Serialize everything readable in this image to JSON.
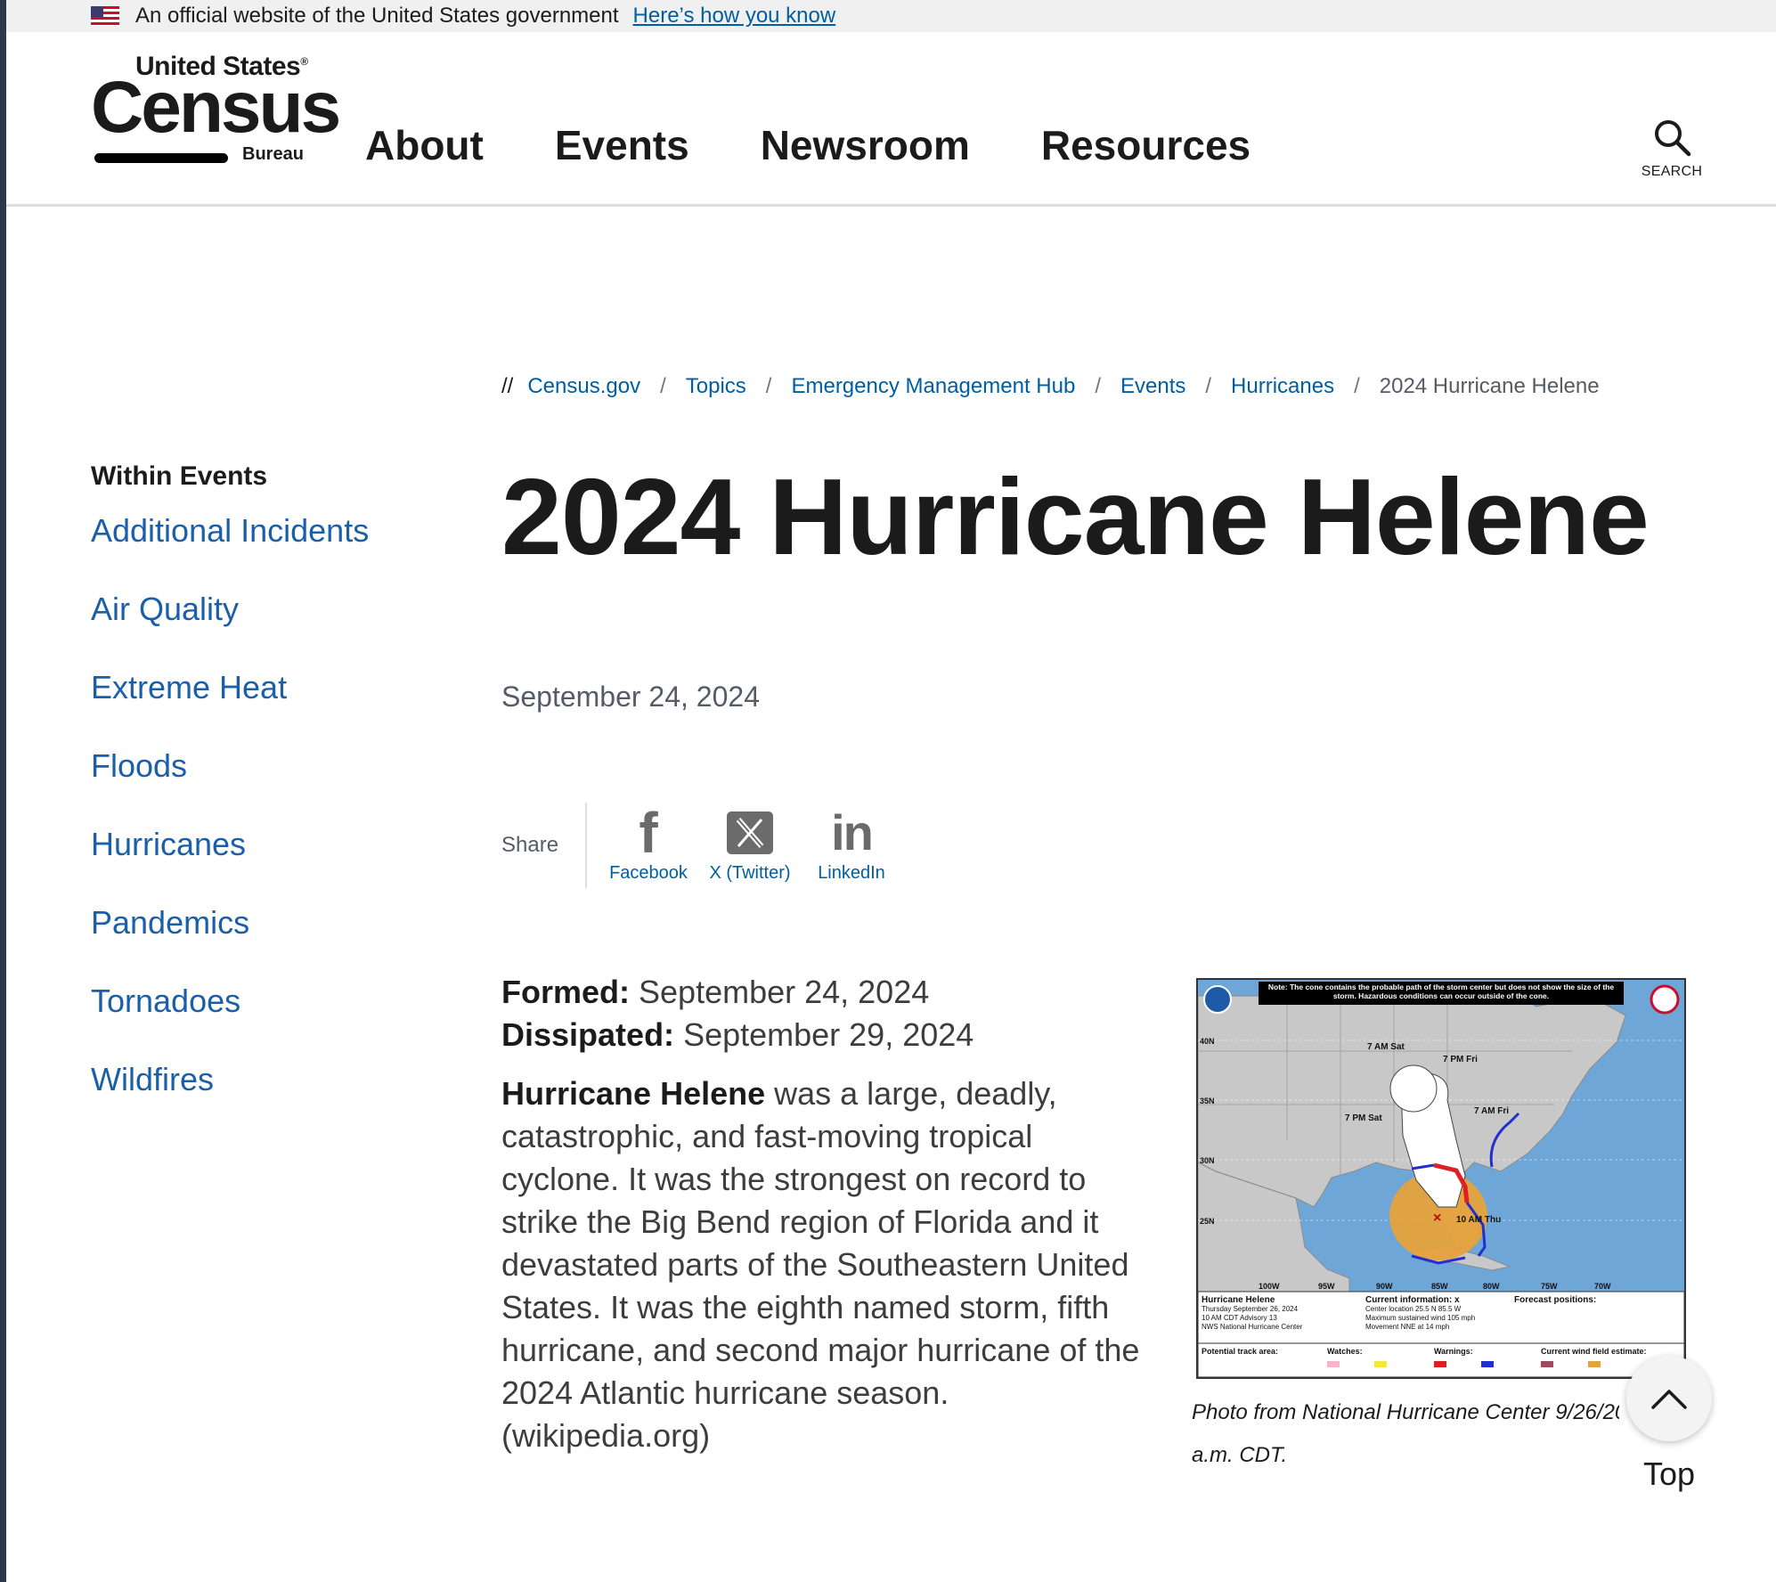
{
  "banner": {
    "text": "An official website of the United States government",
    "link": "Here’s how you know"
  },
  "logo": {
    "top_line": "United States",
    "word": "Census",
    "bottom_line": "Bureau"
  },
  "nav": {
    "items": [
      "About",
      "Events",
      "Newsroom",
      "Resources"
    ]
  },
  "search": {
    "label": "SEARCH"
  },
  "breadcrumb": {
    "prefix": "//",
    "items": [
      "Census.gov",
      "Topics",
      "Emergency Management Hub",
      "Events",
      "Hurricanes"
    ],
    "current": "2024 Hurricane Helene"
  },
  "sidebar": {
    "heading": "Within Events",
    "items": [
      "Additional Incidents",
      "Air Quality",
      "Extreme Heat",
      "Floods",
      "Hurricanes",
      "Pandemics",
      "Tornadoes",
      "Wildfires"
    ]
  },
  "page": {
    "title": "2024 Hurricane Helene",
    "date": "September 24, 2024"
  },
  "share": {
    "label": "Share",
    "facebook": "Facebook",
    "twitter": "X (Twitter)",
    "linkedin": "LinkedIn"
  },
  "facts": {
    "formed_label": "Formed:",
    "formed_value": "September 24, 2024",
    "dissipated_label": "Dissipated:",
    "dissipated_value": "September 29, 2024"
  },
  "description": {
    "bold": "Hurricane Helene",
    "rest": " was a large, deadly, catastrophic, and fast-moving tropical cyclone. It was the strongest on record to strike the Big Bend region of Florida and it devastated parts of the Southeastern United States. It was the eighth named storm, fifth hurricane, and second major hurricane of the 2024 Atlantic hurricane season. (wikipedia.org)"
  },
  "map": {
    "note": "Note: The cone contains the probable path of the storm center but does not show the size of the storm. Hazardous conditions can occur outside of the cone.",
    "storm_name": "Hurricane Helene",
    "advisory_date": "Thursday September 26, 2024",
    "advisory": "10 AM CDT Advisory 13",
    "center": "NWS National Hurricane Center",
    "current_info": "Current information: x",
    "center_location": "Center location 25.5 N 85.5 W",
    "max_wind": "Maximum sustained wind 105 mph",
    "movement": "Movement NNE at 14 mph",
    "forecast_positions": "Forecast positions:",
    "potential_track": "Potential track area:",
    "watches": "Watches:",
    "warnings": "Warnings:",
    "wind_field": "Current wind field estimate:",
    "labels_time": [
      "7 AM Sat",
      "7 PM Fri",
      "7 PM Sat",
      "7 AM Fri",
      "10 AM Thu"
    ],
    "lat_labels": [
      "40N",
      "35N",
      "30N",
      "25N"
    ],
    "lon_labels": [
      "100W",
      "95W",
      "90W",
      "85W",
      "80W",
      "75W",
      "70W"
    ],
    "colors": {
      "ocean": "#6fa6d8",
      "land": "#c8c8c8",
      "cone": "#ffffff",
      "wind": "#e6a23c",
      "warning_hurricane": "#e02020",
      "warning_trop": "#2030d0"
    }
  },
  "caption": {
    "line1": "Photo from National Hurricane Center 9/26/2024",
    "line2": "a.m. CDT."
  },
  "top_button": {
    "label": "Top"
  }
}
